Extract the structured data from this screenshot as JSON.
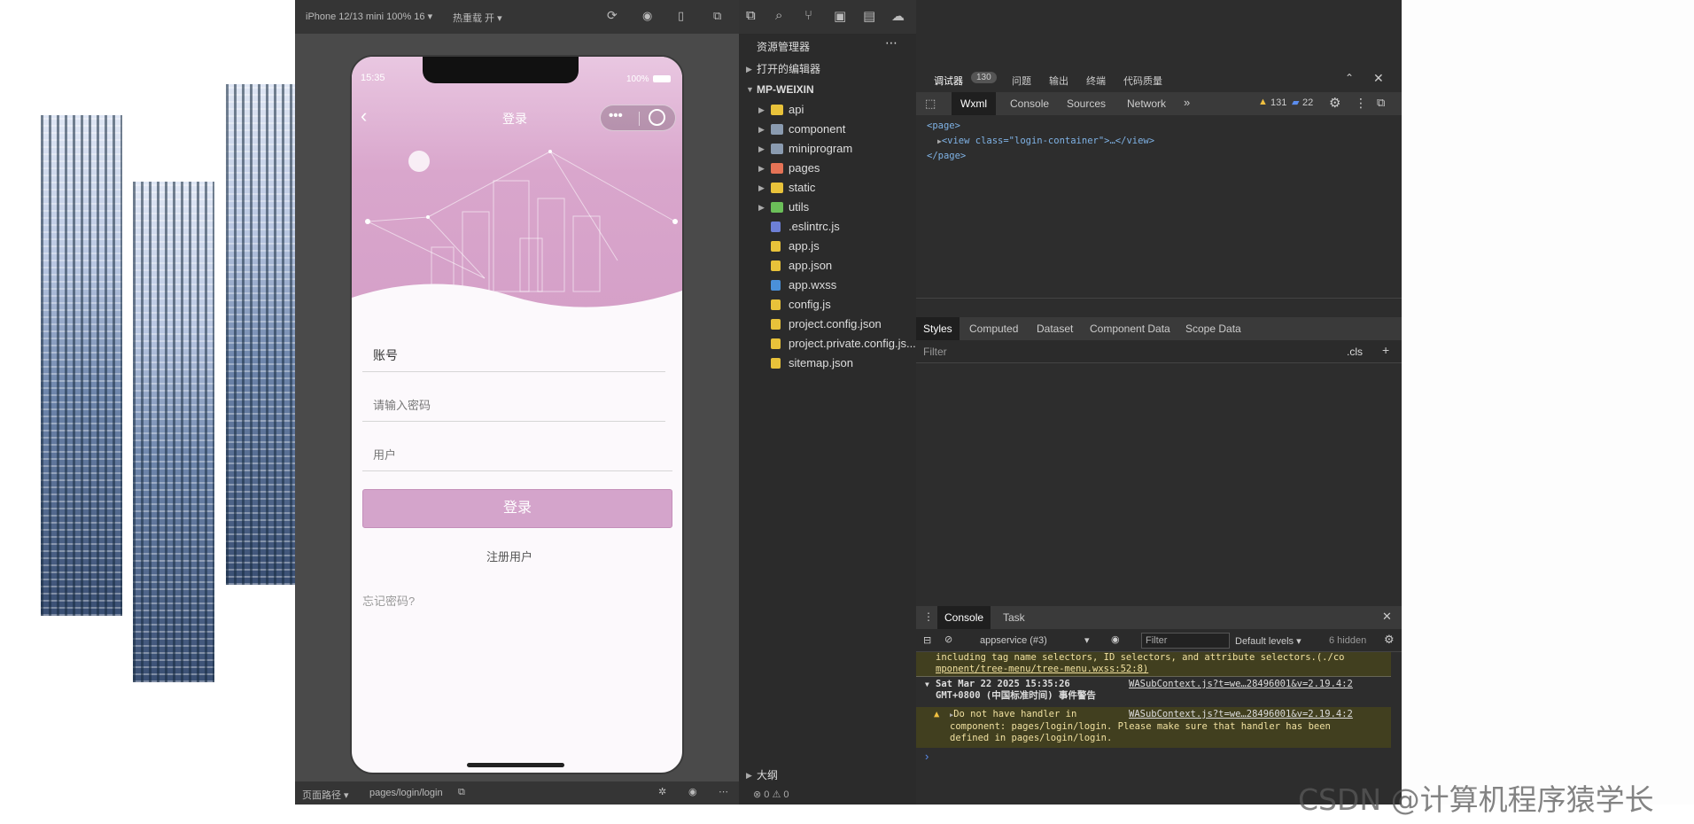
{
  "simulator": {
    "device": "iPhone 12/13 mini 100% 16 ▾",
    "hotreload": "热重载 开 ▾",
    "path_label": "页面路径 ▾",
    "path": "pages/login/login"
  },
  "phone": {
    "time": "15:35",
    "battery": "100%",
    "nav_title": "登录",
    "account_value": "账号",
    "password_placeholder": "请输入密码",
    "role_value": "用户",
    "login_button": "登录",
    "register_link": "注册用户",
    "forgot_link": "忘记密码?"
  },
  "explorer": {
    "title": "资源管理器",
    "open_editors": "打开的编辑器",
    "project": "MP-WEIXIN",
    "outline": "大纲",
    "status": "⊗ 0 ⚠ 0",
    "items": [
      {
        "name": "api",
        "type": "folder",
        "color": "#e8c23a"
      },
      {
        "name": "component",
        "type": "folder",
        "color": "#8a9bb0"
      },
      {
        "name": "miniprogram",
        "type": "folder",
        "color": "#8a9bb0"
      },
      {
        "name": "pages",
        "type": "folder",
        "color": "#e57356"
      },
      {
        "name": "static",
        "type": "folder",
        "color": "#e8c23a"
      },
      {
        "name": "utils",
        "type": "folder",
        "color": "#6bbf59"
      },
      {
        "name": ".eslintrc.js",
        "type": "file",
        "color": "#6d7fd6"
      },
      {
        "name": "app.js",
        "type": "file",
        "color": "#e8c23a"
      },
      {
        "name": "app.json",
        "type": "file",
        "color": "#e8c23a"
      },
      {
        "name": "app.wxss",
        "type": "file",
        "color": "#4a90d9"
      },
      {
        "name": "config.js",
        "type": "file",
        "color": "#e8c23a"
      },
      {
        "name": "project.config.json",
        "type": "file",
        "color": "#e8c23a"
      },
      {
        "name": "project.private.config.js...",
        "type": "file",
        "color": "#e8c23a"
      },
      {
        "name": "sitemap.json",
        "type": "file",
        "color": "#e8c23a"
      }
    ]
  },
  "devtools": {
    "top_tabs": [
      "调试器",
      "问题",
      "输出",
      "终端",
      "代码质量"
    ],
    "debugger_badge": "130",
    "panel_tabs": [
      "Wxml",
      "Console",
      "Sources",
      "Network"
    ],
    "warnings": "131",
    "messages": "22",
    "wxml": [
      "<page>",
      "<view class=\"login-container\">…</view>",
      "</page>"
    ],
    "style_tabs": [
      "Styles",
      "Computed",
      "Dataset",
      "Component Data",
      "Scope Data"
    ],
    "filter": "Filter",
    "cls": ".cls",
    "console_tabs": [
      "Console",
      "Task"
    ],
    "context": "appservice (#3)",
    "console_filter": "Filter",
    "levels": "Default levels ▾",
    "hidden": "6 hidden",
    "log1a": "including tag name selectors, ID selectors, and attribute selectors.(./co",
    "log1b": "mponent/tree-menu/tree-menu.wxss:52:8)",
    "log2_date": "Sat Mar 22 2025 15:35:26",
    "log2_link": "WASubContext.js?t=we…28496001&v=2.19.4:2",
    "log2_b": "GMT+0800 (中国标准时间) 事件警告",
    "log3_a": "Do not have  handler in",
    "log3_link": "WASubContext.js?t=we…28496001&v=2.19.4:2",
    "log3_b": "component: pages/login/login. Please make sure that  handler has been",
    "log3_c": "defined in pages/login/login.",
    "prompt": "›"
  },
  "watermark": "CSDN @计算机程序猿学长"
}
